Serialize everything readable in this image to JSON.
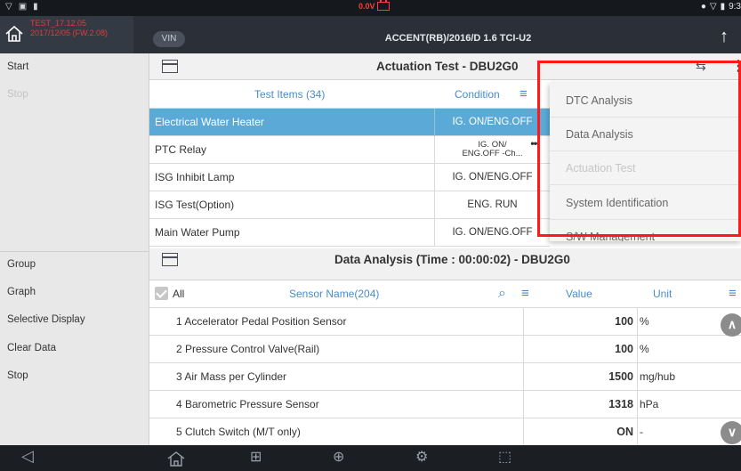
{
  "status_bar": {
    "voltage": "0.0V",
    "clock": "9:3"
  },
  "header": {
    "version_line1": "TEST_17.12.05",
    "version_line2": "2017/12/05 (FW.2.08)",
    "vin_label": "VIN",
    "vehicle": "ACCENT(RB)/2016/D 1.6 TCI-U2"
  },
  "sidebar": {
    "top_items": [
      {
        "label": "Start",
        "enabled": true
      },
      {
        "label": "Stop",
        "enabled": false
      }
    ],
    "bottom_items": [
      {
        "label": "Group"
      },
      {
        "label": "Graph"
      },
      {
        "label": "Selective Display"
      },
      {
        "label": "Clear Data"
      },
      {
        "label": "Stop"
      }
    ]
  },
  "actuation": {
    "title": "Actuation Test - DBU2G0",
    "col_items": "Test Items (34)",
    "col_condition": "Condition",
    "rows": [
      {
        "name": "Electrical Water Heater",
        "condition": "IG. ON/ENG.OFF",
        "selected": true
      },
      {
        "name": "PTC Relay",
        "condition_line1": "IG. ON/",
        "condition_line2": "ENG.OFF -Ch...",
        "more": "•••"
      },
      {
        "name": "ISG Inhibit Lamp",
        "condition": "IG. ON/ENG.OFF"
      },
      {
        "name": "ISG Test(Option)",
        "condition": "ENG. RUN"
      },
      {
        "name": "Main Water Pump",
        "condition": "IG. ON/ENG.OFF"
      }
    ]
  },
  "data_analysis": {
    "title": "Data Analysis (Time : 00:00:02) - DBU2G0",
    "col_all": "All",
    "col_sensor": "Sensor Name(204)",
    "col_value": "Value",
    "col_unit": "Unit",
    "rows": [
      {
        "name": "1 Accelerator Pedal Position Sensor",
        "value": "100",
        "unit": "%"
      },
      {
        "name": "2 Pressure Control Valve(Rail)",
        "value": "100",
        "unit": "%"
      },
      {
        "name": "3 Air Mass per Cylinder",
        "value": "1500",
        "unit": "mg/hub"
      },
      {
        "name": "4 Barometric Pressure Sensor",
        "value": "1318",
        "unit": "hPa"
      },
      {
        "name": "5 Clutch Switch (M/T only)",
        "value": "ON",
        "unit": "-"
      }
    ]
  },
  "menu": {
    "items": [
      {
        "label": "DTC Analysis",
        "enabled": true
      },
      {
        "label": "Data Analysis",
        "enabled": true
      },
      {
        "label": "Actuation Test",
        "enabled": false
      },
      {
        "label": "System Identification",
        "enabled": true
      },
      {
        "label": "S/W Management",
        "enabled": true
      }
    ]
  },
  "colors": {
    "selected_row": "#5aa9d6",
    "header_text": "#4a8cc9",
    "highlight": "#ff1a1a"
  }
}
